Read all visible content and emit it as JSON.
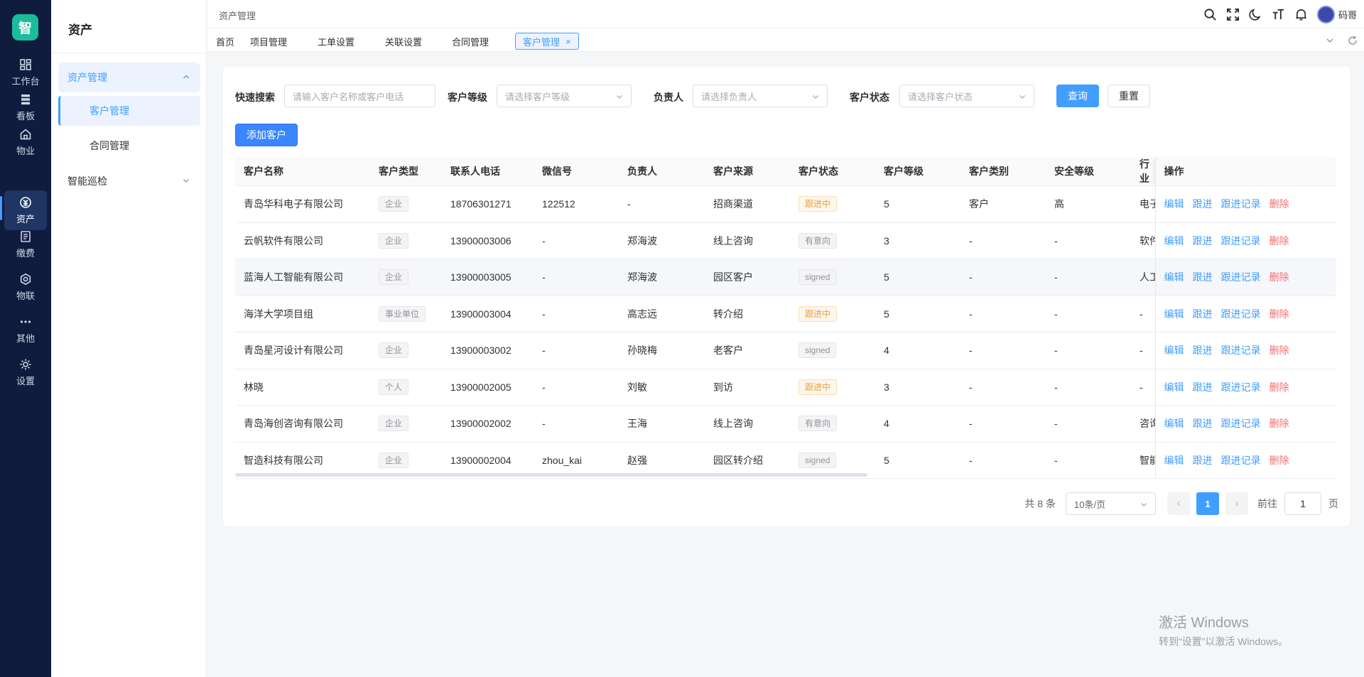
{
  "app": {
    "logo_text": "智"
  },
  "rail": [
    {
      "label": "工作台",
      "icon": "dashboard-icon"
    },
    {
      "label": "看板",
      "icon": "board-icon"
    },
    {
      "label": "物业",
      "icon": "home-icon"
    },
    {
      "label": "资产",
      "icon": "asset-icon"
    },
    {
      "label": "缴费",
      "icon": "bill-icon"
    },
    {
      "label": "物联",
      "icon": "iot-icon"
    },
    {
      "label": "其他",
      "icon": "more-icon"
    },
    {
      "label": "设置",
      "icon": "settings-icon"
    }
  ],
  "submenu": {
    "title": "资产",
    "group": "资产管理",
    "items": [
      "客户管理",
      "合同管理"
    ],
    "group2": "智能巡检"
  },
  "header": {
    "breadcrumb": "资产管理",
    "user": "码哥",
    "icons": [
      "search-icon",
      "fullscreen-icon",
      "moon-icon",
      "font-size-icon",
      "bell-icon"
    ]
  },
  "tabs": [
    {
      "label": "首页"
    },
    {
      "label": "项目管理"
    },
    {
      "label": "工单设置"
    },
    {
      "label": "关联设置"
    },
    {
      "label": "合同管理"
    },
    {
      "label": "客户管理",
      "close": "×"
    }
  ],
  "filters": {
    "quick_search_label": "快速搜索",
    "quick_search_placeholder": "请输入客户名称或客户电话",
    "level_label": "客户等级",
    "level_placeholder": "请选择客户等级",
    "owner_label": "负责人",
    "owner_placeholder": "请选择负责人",
    "status_label": "客户状态",
    "status_placeholder": "请选择客户状态",
    "query_button": "查询",
    "reset_button": "重置",
    "add_button": "添加客户"
  },
  "table": {
    "headers": [
      "客户名称",
      "客户类型",
      "联系人电话",
      "微信号",
      "负责人",
      "客户来源",
      "客户状态",
      "客户等级",
      "客户类别",
      "安全等级",
      "行业",
      "操作"
    ],
    "actions": {
      "edit": "编辑",
      "follow": "跟进",
      "record": "跟进记录",
      "delete": "删除"
    },
    "rows": [
      {
        "name": "青岛华科电子有限公司",
        "type": "企业",
        "phone": "18706301271",
        "wechat": "122512",
        "owner": "-",
        "source": "招商渠道",
        "status": "跟进中",
        "status_kind": "warn",
        "level": "5",
        "category": "客户",
        "safety": "高",
        "industry": "电子"
      },
      {
        "name": "云帆软件有限公司",
        "type": "企业",
        "phone": "13900003006",
        "wechat": "-",
        "owner": "郑海波",
        "source": "线上咨询",
        "status": "有意向",
        "status_kind": "info",
        "level": "3",
        "category": "-",
        "safety": "-",
        "industry": "软件"
      },
      {
        "name": "蓝海人工智能有限公司",
        "type": "企业",
        "phone": "13900003005",
        "wechat": "-",
        "owner": "郑海波",
        "source": "园区客户",
        "status": "signed",
        "status_kind": "info",
        "level": "5",
        "category": "-",
        "safety": "-",
        "industry": "人工"
      },
      {
        "name": "海洋大学项目组",
        "type": "事业单位",
        "phone": "13900003004",
        "wechat": "-",
        "owner": "高志远",
        "source": "转介绍",
        "status": "跟进中",
        "status_kind": "warn",
        "level": "5",
        "category": "-",
        "safety": "-",
        "industry": "-"
      },
      {
        "name": "青岛星河设计有限公司",
        "type": "企业",
        "phone": "13900003002",
        "wechat": "-",
        "owner": "孙晓梅",
        "source": "老客户",
        "status": "signed",
        "status_kind": "info",
        "level": "4",
        "category": "-",
        "safety": "-",
        "industry": "-"
      },
      {
        "name": "林晓",
        "type": "个人",
        "phone": "13900002005",
        "wechat": "-",
        "owner": "刘敏",
        "source": "到访",
        "status": "跟进中",
        "status_kind": "warn",
        "level": "3",
        "category": "-",
        "safety": "-",
        "industry": "-"
      },
      {
        "name": "青岛海创咨询有限公司",
        "type": "企业",
        "phone": "13900002002",
        "wechat": "-",
        "owner": "王海",
        "source": "线上咨询",
        "status": "有意向",
        "status_kind": "info",
        "level": "4",
        "category": "-",
        "safety": "-",
        "industry": "咨询"
      },
      {
        "name": "智造科技有限公司",
        "type": "企业",
        "phone": "13900002004",
        "wechat": "zhou_kai",
        "owner": "赵强",
        "source": "园区转介绍",
        "status": "signed",
        "status_kind": "info",
        "level": "5",
        "category": "-",
        "safety": "-",
        "industry": "智能"
      }
    ]
  },
  "pagination": {
    "total": "共 8 条",
    "page_size": "10条/页",
    "current_page": "1",
    "goto_label": "前往",
    "goto_value": "1",
    "page_unit": "页"
  },
  "watermark": {
    "line1": "激活 Windows",
    "line2": "转到“设置”以激活 Windows。"
  }
}
